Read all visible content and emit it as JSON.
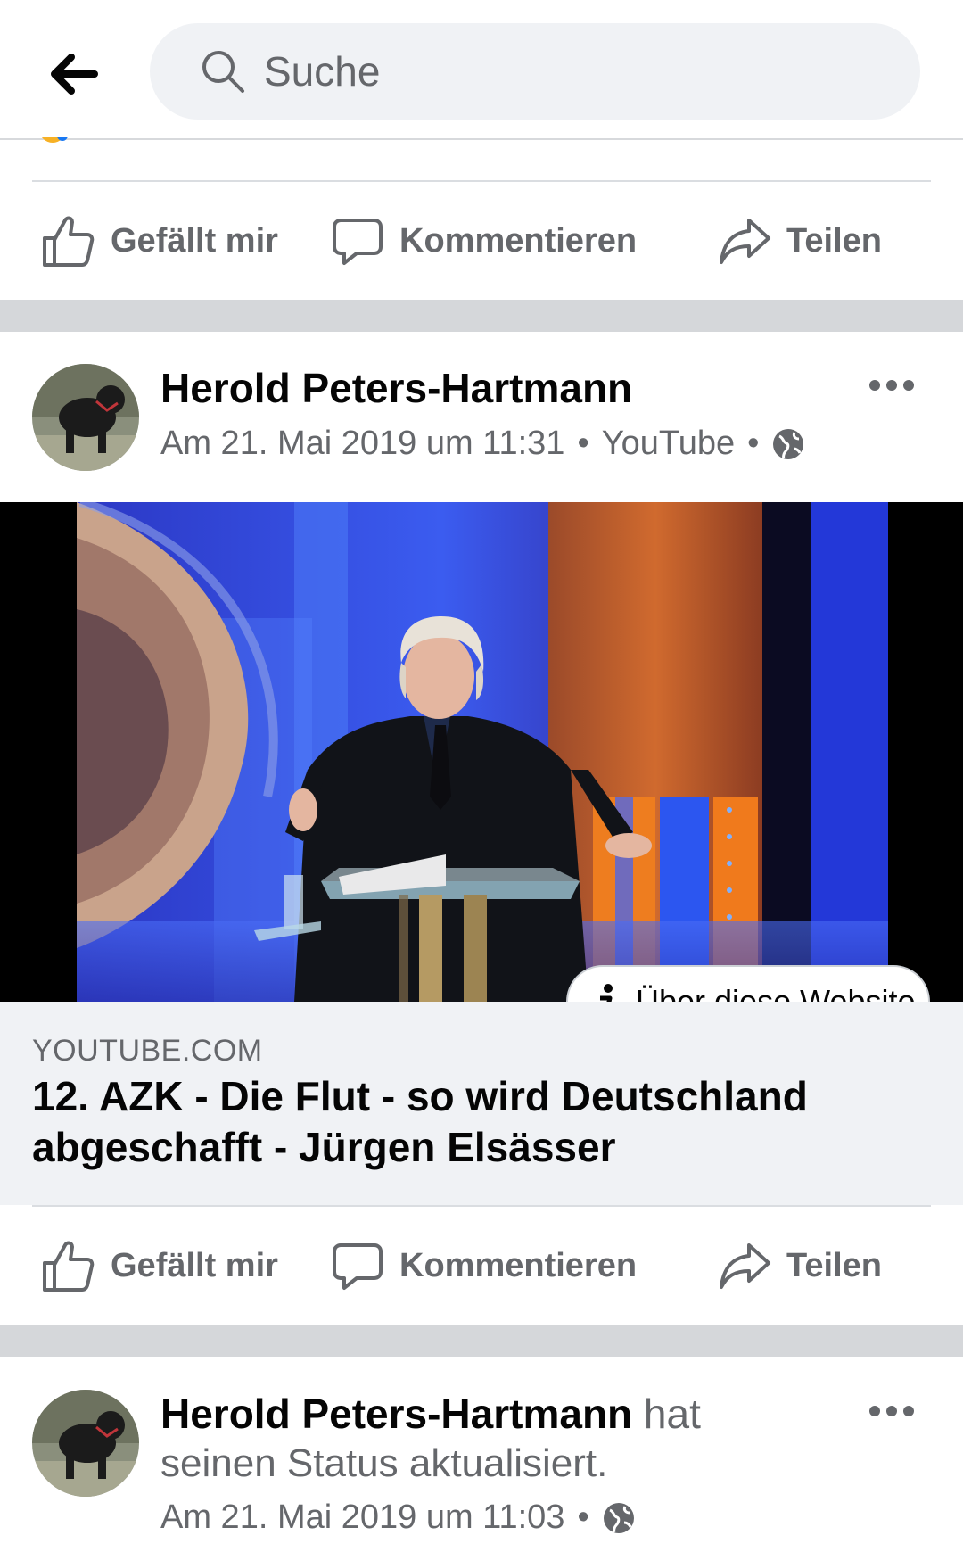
{
  "search": {
    "placeholder": "Suche"
  },
  "actions": {
    "like": "Gefällt mir",
    "comment": "Kommentieren",
    "share": "Teilen"
  },
  "post1": {
    "author": "Herold Peters-Hartmann",
    "date": "Am 21. Mai 2019 um 11:31",
    "separator": "•",
    "source": "YouTube",
    "link": {
      "about_label": "Über diese Website",
      "domain": "YOUTUBE.COM",
      "title": "12. AZK - Die Flut - so wird Deutschland abgeschafft - Jürgen Elsässer"
    }
  },
  "post2": {
    "author": "Herold Peters-Hartmann",
    "status_prefix": "hat",
    "status_rest": "seinen Status aktualisiert.",
    "date": "Am 21. Mai 2019 um 11:03",
    "separator": "•"
  },
  "icons": {
    "back": "arrow-left-icon",
    "search": "search-icon",
    "like": "thumbs-up-icon",
    "comment": "speech-bubble-icon",
    "share": "share-arrow-icon",
    "globe": "globe-icon",
    "more": "more-horizontal-icon",
    "info": "info-icon"
  },
  "colors": {
    "secondary_text": "#65676b",
    "search_bg": "#f0f2f5",
    "separator_band": "#d5d7da"
  }
}
